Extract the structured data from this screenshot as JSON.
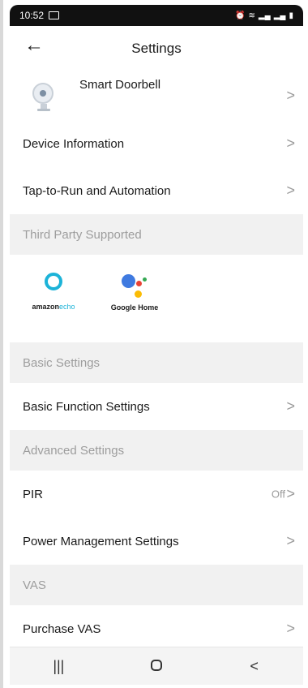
{
  "status": {
    "time": "10:52",
    "icons": [
      "image-icon",
      "alarm-icon",
      "wifi-icon",
      "signal-icon",
      "signal-icon",
      "battery-icon"
    ]
  },
  "header": {
    "title": "Settings",
    "back_icon": "arrow-left-icon"
  },
  "device": {
    "name": "Smart Doorbell"
  },
  "rows_top": [
    {
      "label": "Device Information"
    },
    {
      "label": "Tap-to-Run and Automation"
    }
  ],
  "third_party": {
    "heading": "Third Party Supported",
    "amazon": {
      "brand": "amazon",
      "product": "echo"
    },
    "google": {
      "label": "Google Home"
    }
  },
  "basic": {
    "heading": "Basic Settings",
    "row_label": "Basic Function Settings"
  },
  "advanced": {
    "heading": "Advanced Settings",
    "pir_label": "PIR",
    "pir_value": "Off",
    "power_label": "Power Management Settings"
  },
  "vas": {
    "heading": "VAS",
    "row_label": "Purchase VAS"
  },
  "chevron": ">",
  "navbar": {
    "recent": "|||",
    "home": "",
    "back": "<"
  }
}
